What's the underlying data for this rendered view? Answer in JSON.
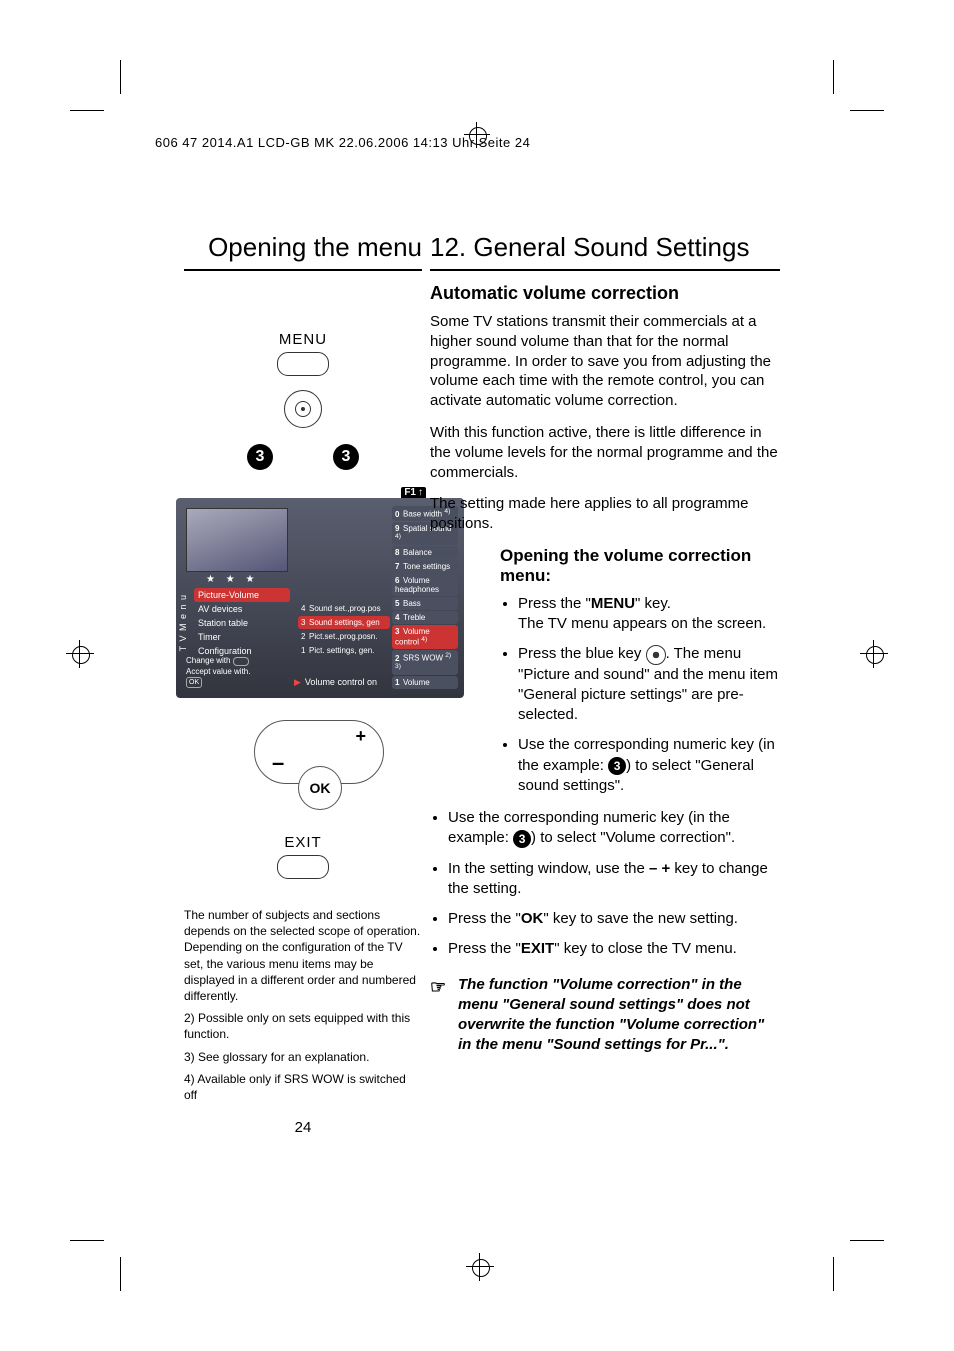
{
  "header": "606 47 2014.A1 LCD-GB MK  22.06.2006  14:13 Uhr  Seite 24",
  "page_number": "24",
  "left": {
    "title": "Opening the menu",
    "remote": {
      "menu_label": "MENU",
      "circled_number": "3",
      "ok_label": "OK",
      "exit_label": "EXIT",
      "plus": "+",
      "minus": "–"
    },
    "osd": {
      "vert_tab": "T V  M e n u",
      "f1": "F1",
      "left_items": [
        "Picture-Volume",
        "AV devices",
        "Station table",
        "Timer",
        "Configuration"
      ],
      "mid_items": [
        {
          "n": "4",
          "t": "Sound set.,prog.pos"
        },
        {
          "n": "3",
          "t": "Sound settings, gen"
        },
        {
          "n": "2",
          "t": "Pict.set.,prog.posn."
        },
        {
          "n": "1",
          "t": "Pict. settings, gen."
        }
      ],
      "right_items": [
        {
          "n": "0",
          "t": "Base width",
          "sup": "4)"
        },
        {
          "n": "9",
          "t": "Spatial sound",
          "sup": "4)"
        },
        {
          "n": "8",
          "t": "Balance",
          "sup": ""
        },
        {
          "n": "7",
          "t": "Tone settings",
          "sup": ""
        },
        {
          "n": "6",
          "t": "Volume headphones",
          "sup": ""
        },
        {
          "n": "5",
          "t": "Bass",
          "sup": ""
        },
        {
          "n": "4",
          "t": "Treble",
          "sup": ""
        },
        {
          "n": "3",
          "t": "Volume control",
          "sup": "4)"
        },
        {
          "n": "2",
          "t": "SRS WOW",
          "sup": "2) 3)"
        },
        {
          "n": "1",
          "t": "Volume",
          "sup": ""
        }
      ],
      "hint_change": "Change with",
      "hint_accept": "Accept value with.",
      "hint_ok": "OK",
      "footer": "Volume control    on",
      "stars": "★ ★ ★"
    },
    "fineprint": {
      "p1": "The number of subjects and sections depends on the selected scope of operation. Depending on the configuration of the TV set, the various menu items may be displayed in a different order and numbered differently.",
      "p2": "2) Possible only on sets equipped with this function.",
      "p3": "3) See glossary for an explanation.",
      "p4": "4) Available only if SRS WOW is switched off"
    }
  },
  "right": {
    "title": "12. General Sound Settings",
    "subtitle": "Automatic volume correction",
    "para1": "Some TV stations transmit their commercials at a higher sound volume than that for the normal programme. In order to save you from adjusting the volume each time with the remote control, you can activate automatic volume correction.",
    "para2": "With this function active, there is little difference in the volume levels for the normal programme and the commercials.",
    "para3": "The setting made here applies to all programme positions.",
    "step_heading": "Opening the volume correction menu:",
    "steps_indented": [
      {
        "pre": "Press the \"",
        "b": "MENU",
        "post": "\" key.",
        "line2": "The TV menu appears on the screen."
      },
      {
        "pre": "Press the blue key ",
        "icon": "blue-key",
        "post": ". The menu \"Picture and sound\" and the menu item \"General picture settings\" are pre-selected."
      },
      {
        "pre": "Use the corresponding numeric key (in the example: ",
        "num": "3",
        "post": ") to select \"General sound settings\"."
      }
    ],
    "steps_full": [
      {
        "pre": "Use the corresponding numeric key (in the example: ",
        "num": "3",
        "post": ") to select \"Volume correction\"."
      },
      {
        "pre": "In the setting window, use the ",
        "b": "– +",
        "post": " key to change the setting."
      },
      {
        "pre": "Press the \"",
        "b": "OK",
        "post": "\" key to save the new setting."
      },
      {
        "pre": "Press the \"",
        "b": "EXIT",
        "post": "\" key to close the TV menu."
      }
    ],
    "note": "The function \"Volume correction\" in the menu \"General sound settings\" does not overwrite the function \"Volume correction\" in the menu \"Sound settings for Pr...\"."
  }
}
